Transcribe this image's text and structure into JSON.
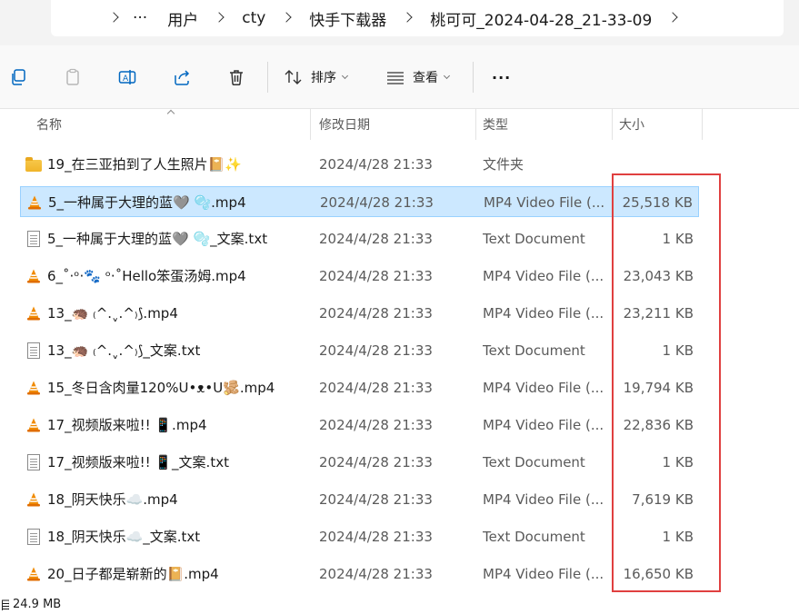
{
  "address_bar": {
    "segments": [
      "···",
      "用户",
      "cty",
      "快手下载器",
      "桃可可_2024-04-28_21-33-09"
    ]
  },
  "toolbar": {
    "sort_label": "排序",
    "view_label": "查看",
    "more_label": "···"
  },
  "columns": {
    "name": "名称",
    "date": "修改日期",
    "type": "类型",
    "size": "大小"
  },
  "files": [
    {
      "icon": "folder-icon",
      "name": "19_在三亚拍到了人生照片📔✨",
      "date": "2024/4/28 21:33",
      "type": "文件夹",
      "size": ""
    },
    {
      "icon": "vlc-icon",
      "name": "5_一种属于大理的蓝🩶 🫧.mp4",
      "date": "2024/4/28 21:33",
      "type": "MP4 Video File (...",
      "size": "25,518 KB",
      "selected": true
    },
    {
      "icon": "text-document-icon",
      "name": "5_一种属于大理的蓝🩶 🫧_文案.txt",
      "date": "2024/4/28 21:33",
      "type": "Text Document",
      "size": "1 KB"
    },
    {
      "icon": "vlc-icon",
      "name": "6_˚·ᵒ·🐾 ᵒ·˚Hello笨蛋汤姆.mp4",
      "date": "2024/4/28 21:33",
      "type": "MP4 Video File (...",
      "size": "23,043 KB"
    },
    {
      "icon": "vlc-icon",
      "name": "13_🦔 ₍^.ˬ.^₎⟆.mp4",
      "date": "2024/4/28 21:33",
      "type": "MP4 Video File (...",
      "size": "23,211 KB"
    },
    {
      "icon": "text-document-icon",
      "name": "13_🦔 ₍^.ˬ.^₎⟆_文案.txt",
      "date": "2024/4/28 21:33",
      "type": "Text Document",
      "size": "1 KB"
    },
    {
      "icon": "vlc-icon",
      "name": "15_冬日含肉量120%U•ᴥ•U🫚.mp4",
      "date": "2024/4/28 21:33",
      "type": "MP4 Video File (...",
      "size": "19,794 KB"
    },
    {
      "icon": "vlc-icon",
      "name": "17_视频版来啦!! 📱.mp4",
      "date": "2024/4/28 21:33",
      "type": "MP4 Video File (...",
      "size": "22,836 KB"
    },
    {
      "icon": "text-document-icon",
      "name": "17_视频版来啦!! 📱_文案.txt",
      "date": "2024/4/28 21:33",
      "type": "Text Document",
      "size": "1 KB"
    },
    {
      "icon": "vlc-icon",
      "name": "18_阴天快乐☁️.mp4",
      "date": "2024/4/28 21:33",
      "type": "MP4 Video File (...",
      "size": "7,619 KB"
    },
    {
      "icon": "text-document-icon",
      "name": "18_阴天快乐☁️_文案.txt",
      "date": "2024/4/28 21:33",
      "type": "Text Document",
      "size": "1 KB"
    },
    {
      "icon": "vlc-icon",
      "name": "20_日子都是崭新的📔.mp4",
      "date": "2024/4/28 21:33",
      "type": "MP4 Video File (...",
      "size": "16,650 KB"
    }
  ],
  "status_bar": {
    "count": "目",
    "selection_size": "24.9 MB"
  },
  "colors": {
    "selection": "#cce8ff",
    "highlight_box": "#e04040",
    "vlc_orange": "#f08a00"
  }
}
